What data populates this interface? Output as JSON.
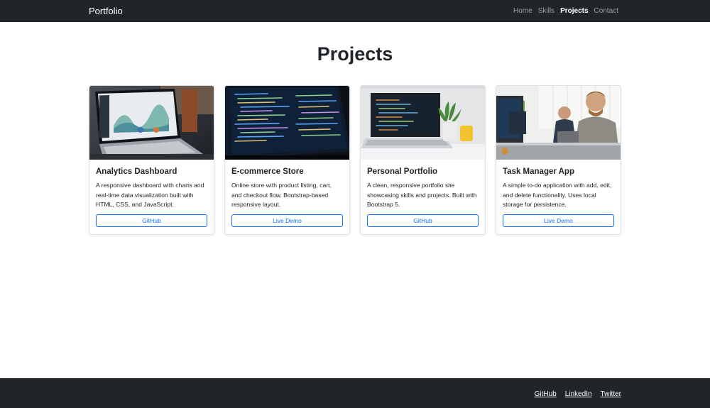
{
  "navbar": {
    "brand": "Portfolio",
    "links": [
      {
        "label": "Home"
      },
      {
        "label": "Skills"
      },
      {
        "label": "Projects"
      },
      {
        "label": "Contact"
      }
    ],
    "active": "Projects"
  },
  "main": {
    "title": "Projects",
    "cards": [
      {
        "title": "Analytics Dashboard",
        "description": "A responsive dashboard with charts and real-time data visualization built with HTML, CSS, and JavaScript.",
        "button": "GitHub",
        "image": "laptop-dashboard-photo"
      },
      {
        "title": "E-commerce Store",
        "description": "Online store with product listing, cart, and checkout flow. Bootstrap-based responsive layout.",
        "button": "Live Demo",
        "image": "laptop-code-photo"
      },
      {
        "title": "Personal Portfolio",
        "description": "A clean, responsive portfolio site showcasing skills and projects. Built with Bootstrap 5.",
        "button": "GitHub",
        "image": "laptop-desk-plant-photo"
      },
      {
        "title": "Task Manager App",
        "description": "A simple to-do application with add, edit, and delete functionality. Uses local storage for persistence.",
        "button": "Live Demo",
        "image": "developers-office-photo"
      }
    ]
  },
  "footer": {
    "links": [
      {
        "label": "GitHub"
      },
      {
        "label": "LinkedIn"
      },
      {
        "label": "Twitter"
      }
    ]
  },
  "colors": {
    "navbar_bg": "#212529",
    "accent": "#0d6efd",
    "text": "#212529"
  }
}
